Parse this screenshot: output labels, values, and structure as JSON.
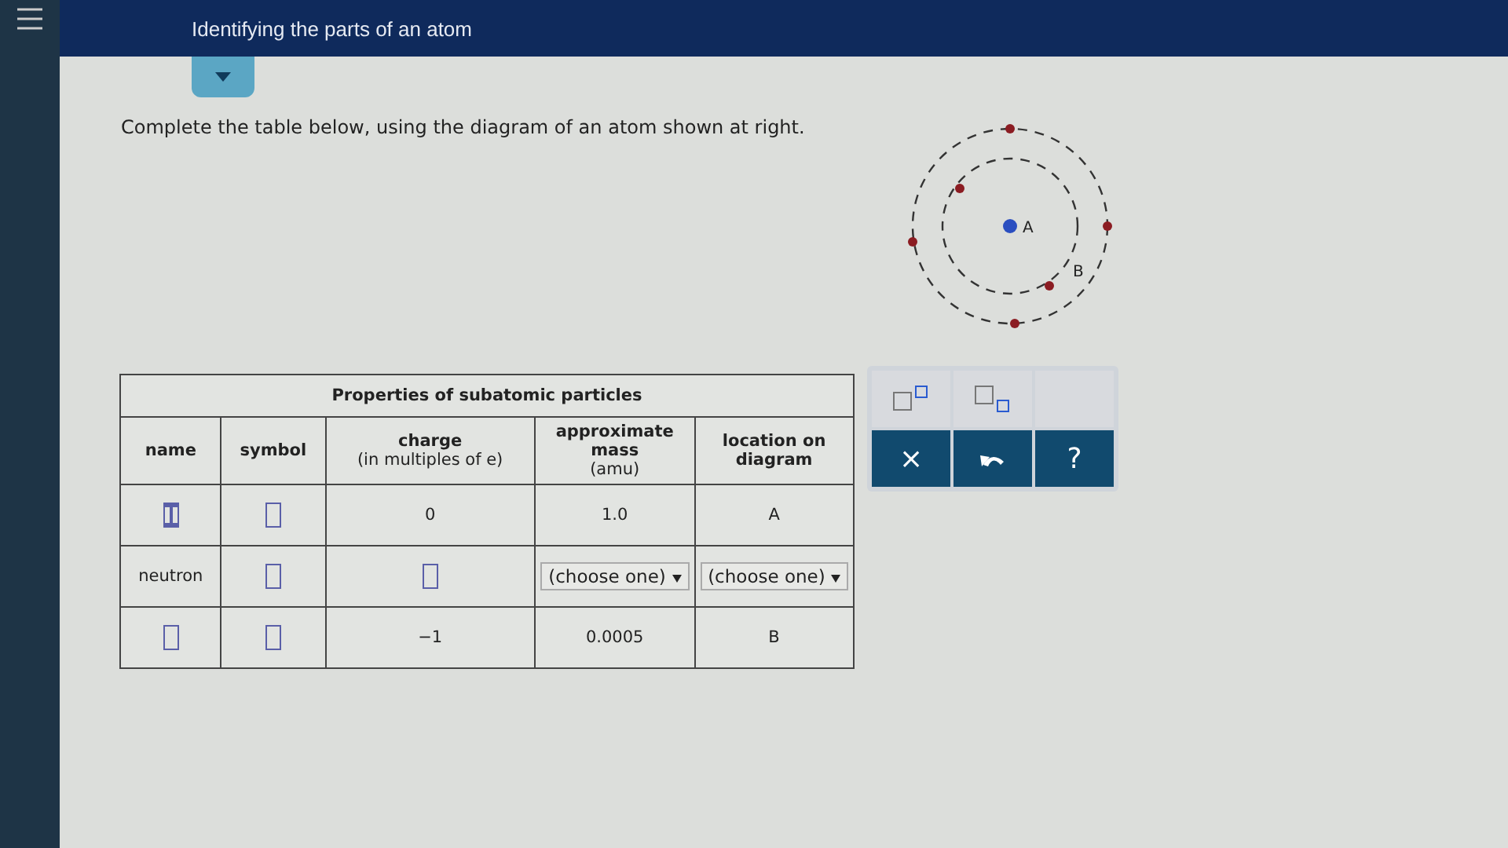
{
  "header": {
    "title": "Identifying the parts of an atom"
  },
  "instruction": "Complete the table below, using the diagram of an atom shown at right.",
  "diagram": {
    "nucleus_label": "A",
    "shell_label": "B"
  },
  "table": {
    "caption": "Properties of subatomic particles",
    "columns": [
      {
        "title": "name"
      },
      {
        "title": "symbol"
      },
      {
        "title": "charge",
        "subtitle": "(in multiples of $_{}$e)"
      },
      {
        "title": "approximate mass",
        "subtitle": "(amu)"
      },
      {
        "title": "location on diagram"
      }
    ],
    "rows": [
      [
        {
          "kind": "field",
          "focused": true
        },
        {
          "kind": "field",
          "focused": false
        },
        {
          "kind": "text",
          "text": "0"
        },
        {
          "kind": "text",
          "text": "1.0"
        },
        {
          "kind": "text",
          "text": "A"
        }
      ],
      [
        {
          "kind": "text",
          "text": "neutron"
        },
        {
          "kind": "field",
          "focused": false
        },
        {
          "kind": "field",
          "focused": false
        },
        {
          "kind": "select",
          "text": "(choose one)"
        },
        {
          "kind": "select",
          "text": "(choose one)"
        }
      ],
      [
        {
          "kind": "field",
          "focused": false
        },
        {
          "kind": "field",
          "focused": false
        },
        {
          "kind": "text",
          "text": "−1"
        },
        {
          "kind": "text",
          "text": "0.0005"
        },
        {
          "kind": "text",
          "text": "B"
        }
      ]
    ]
  },
  "keypad": {
    "templates": [
      {
        "kind": "superscript"
      },
      {
        "kind": "subscript"
      }
    ],
    "actions": [
      {
        "kind": "clear",
        "label": "×"
      },
      {
        "kind": "undo"
      },
      {
        "kind": "help",
        "label": "?"
      }
    ]
  }
}
